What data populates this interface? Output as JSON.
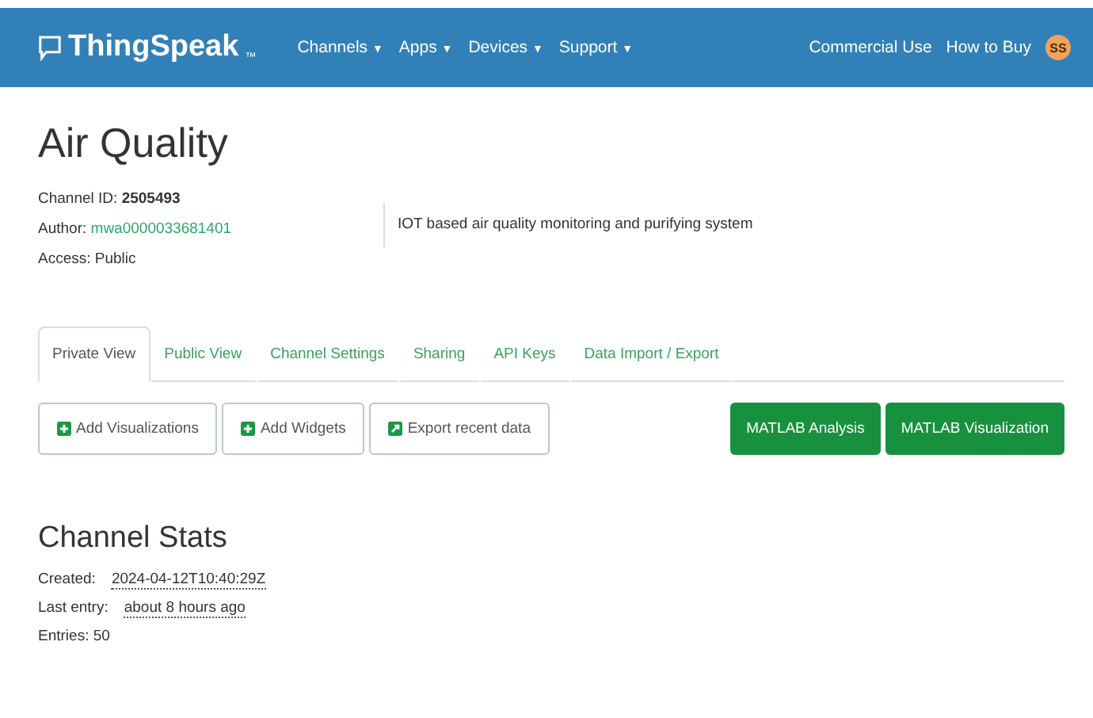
{
  "navbar": {
    "brand": "ThingSpeak",
    "trademark": "™",
    "menus": [
      {
        "label": "Channels",
        "caret": "▼"
      },
      {
        "label": "Apps",
        "caret": "▼"
      },
      {
        "label": "Devices",
        "caret": "▼"
      },
      {
        "label": "Support",
        "caret": "▼"
      }
    ],
    "links": [
      "Commercial Use",
      "How to Buy"
    ],
    "avatar": "SS"
  },
  "channel": {
    "title": "Air Quality",
    "id_label": "Channel ID:",
    "id": "2505493",
    "author_label": "Author:",
    "author": "mwa0000033681401",
    "access": "Access: Public",
    "description": "IOT based air quality monitoring and purifying system"
  },
  "tabs": [
    {
      "label": "Private View",
      "selected": true
    },
    {
      "label": "Public View",
      "selected": false
    },
    {
      "label": "Channel Settings",
      "selected": false
    },
    {
      "label": "Sharing",
      "selected": false
    },
    {
      "label": "API Keys",
      "selected": false
    },
    {
      "label": "Data Import / Export",
      "selected": false
    }
  ],
  "buttons_left": [
    {
      "label": "Add Visualizations",
      "kind": "add"
    },
    {
      "label": "Add Widgets",
      "kind": "add"
    },
    {
      "label": "Export recent data",
      "kind": "export"
    }
  ],
  "buttons_right": [
    "MATLAB Analysis",
    "MATLAB Visualization"
  ],
  "stats": {
    "title": "Channel Stats",
    "created_label": "Created:",
    "created": "2024-04-12T10:40:29Z",
    "last_label": "Last entry:",
    "last": "about 8 hours ago",
    "entries": "Entries: 50"
  }
}
